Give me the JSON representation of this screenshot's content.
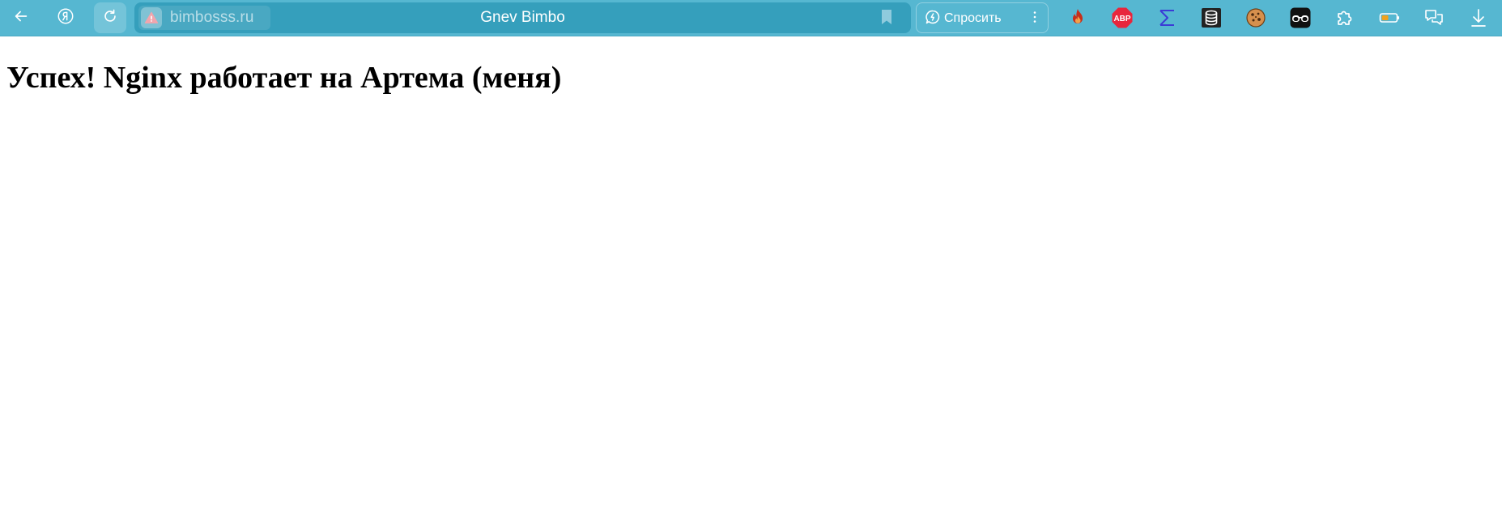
{
  "browser": {
    "address": {
      "host": "bimbosss.ru",
      "security_icon": "warning-icon"
    },
    "page_title": "Gnev Bimbo",
    "ask_button_label": "Спросить",
    "nav_icons": [
      "back-arrow-icon",
      "yandex-logo-icon",
      "reload-icon"
    ],
    "extension_icons": [
      "flame-extension-icon",
      "adblock-plus-icon",
      "sigma-extension-icon",
      "database-extension-icon",
      "cookie-extension-icon",
      "glasses-extension-icon",
      "puzzle-extensions-icon",
      "battery-icon",
      "chat-bubbles-icon",
      "download-icon"
    ],
    "extension_labels": {
      "adblock": "ABP"
    },
    "colors": {
      "toolbar": "#56b7d1",
      "omnibox": "#359fbc",
      "adblock": "#e8263d",
      "sigma": "#3b3bd6"
    }
  },
  "page": {
    "heading": "Успех! Nginx работает на Артема (меня)"
  }
}
